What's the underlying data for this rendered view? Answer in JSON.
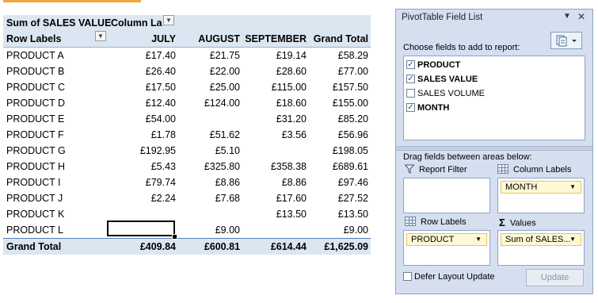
{
  "pivot": {
    "title": "Sum of SALES VALUE",
    "column_labels_caption": "Column La",
    "row_labels_caption": "Row Labels",
    "columns": [
      "JULY",
      "AUGUST",
      "SEPTEMBER",
      "Grand Total"
    ],
    "rows": [
      {
        "label": "PRODUCT A",
        "jul": "£17.40",
        "aug": "£21.75",
        "sep": "£19.14",
        "total": "£58.29"
      },
      {
        "label": "PRODUCT B",
        "jul": "£26.40",
        "aug": "£22.00",
        "sep": "£28.60",
        "total": "£77.00"
      },
      {
        "label": "PRODUCT C",
        "jul": "£17.50",
        "aug": "£25.00",
        "sep": "£115.00",
        "total": "£157.50"
      },
      {
        "label": "PRODUCT D",
        "jul": "£12.40",
        "aug": "£124.00",
        "sep": "£18.60",
        "total": "£155.00"
      },
      {
        "label": "PRODUCT E",
        "jul": "£54.00",
        "aug": "",
        "sep": "£31.20",
        "total": "£85.20"
      },
      {
        "label": "PRODUCT F",
        "jul": "£1.78",
        "aug": "£51.62",
        "sep": "£3.56",
        "total": "£56.96"
      },
      {
        "label": "PRODUCT G",
        "jul": "£192.95",
        "aug": "£5.10",
        "sep": "",
        "total": "£198.05"
      },
      {
        "label": "PRODUCT H",
        "jul": "£5.43",
        "aug": "£325.80",
        "sep": "£358.38",
        "total": "£689.61"
      },
      {
        "label": "PRODUCT I",
        "jul": "£79.74",
        "aug": "£8.86",
        "sep": "£8.86",
        "total": "£97.46"
      },
      {
        "label": "PRODUCT J",
        "jul": "£2.24",
        "aug": "£7.68",
        "sep": "£17.60",
        "total": "£27.52"
      },
      {
        "label": "PRODUCT K",
        "jul": "",
        "aug": "",
        "sep": "£13.50",
        "total": "£13.50"
      },
      {
        "label": "PRODUCT L",
        "jul": "",
        "aug": "£9.00",
        "sep": "",
        "total": "£9.00"
      }
    ],
    "grand_total": {
      "label": "Grand Total",
      "jul": "£409.84",
      "aug": "£600.81",
      "sep": "£614.44",
      "total": "£1,625.09"
    }
  },
  "field_list": {
    "title": "PivotTable Field List",
    "choose_label": "Choose fields to add to report:",
    "fields": [
      {
        "name": "PRODUCT",
        "checked": true
      },
      {
        "name": "SALES VALUE",
        "checked": true
      },
      {
        "name": "SALES VOLUME",
        "checked": false
      },
      {
        "name": "MONTH",
        "checked": true
      }
    ],
    "drag_label": "Drag fields between areas below:",
    "areas": {
      "report_filter": {
        "label": "Report Filter"
      },
      "column_labels": {
        "label": "Column Labels",
        "item": "MONTH"
      },
      "row_labels": {
        "label": "Row Labels",
        "item": "PRODUCT"
      },
      "values": {
        "label": "Values",
        "item": "Sum of SALES..."
      }
    },
    "defer_label": "Defer Layout Update",
    "update_button": "Update"
  },
  "colors": {
    "header_band": "#dce6f1",
    "pane_background": "#d5dff0",
    "chip_background": "#fff8d5",
    "accent_orange": "#f2a53a"
  }
}
